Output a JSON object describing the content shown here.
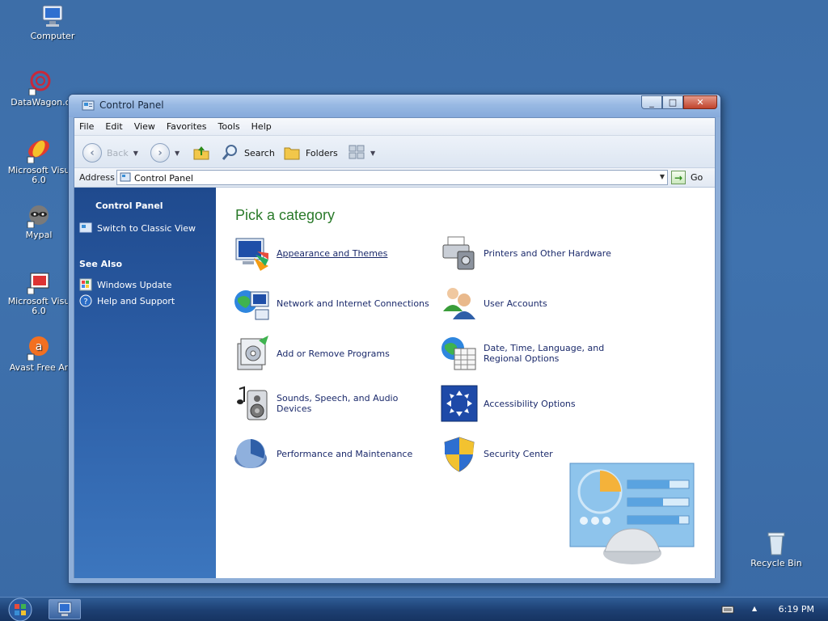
{
  "desktop": {
    "icons": [
      {
        "label": "Computer"
      },
      {
        "label": "DataWagon.c"
      },
      {
        "label": "Microsoft Visu\n6.0"
      },
      {
        "label": "Mypal"
      },
      {
        "label": "Microsoft Visu\n6.0"
      },
      {
        "label": "Avast Free Ar"
      },
      {
        "label": "Recycle Bin"
      }
    ]
  },
  "window": {
    "title": "Control Panel",
    "controls": {
      "minimize": "_",
      "maximize": "□",
      "close": "✕"
    },
    "menu": [
      "File",
      "Edit",
      "View",
      "Favorites",
      "Tools",
      "Help"
    ],
    "toolbar": {
      "back": "Back",
      "search": "Search",
      "folders": "Folders"
    },
    "address": {
      "label": "Address",
      "value": "Control Panel",
      "go": "Go"
    },
    "taskpane": {
      "title": "Control Panel",
      "switch": "Switch to Classic View",
      "see_also": "See Also",
      "links": [
        "Windows Update",
        "Help and Support"
      ]
    },
    "content": {
      "heading": "Pick a category",
      "categories": [
        "Appearance and Themes",
        "Printers and Other Hardware",
        "Network and Internet Connections",
        "User Accounts",
        "Add or Remove Programs",
        "Date, Time, Language, and Regional Options",
        "Sounds, Speech, and Audio Devices",
        "Accessibility Options",
        "Performance and Maintenance",
        "Security Center"
      ]
    }
  },
  "taskbar": {
    "clock": "6:19 PM"
  },
  "colors": {
    "heading_green": "#2a7a2a",
    "taskpane_blue": "#2c5ea6",
    "link_navy": "#1b2a6b"
  }
}
